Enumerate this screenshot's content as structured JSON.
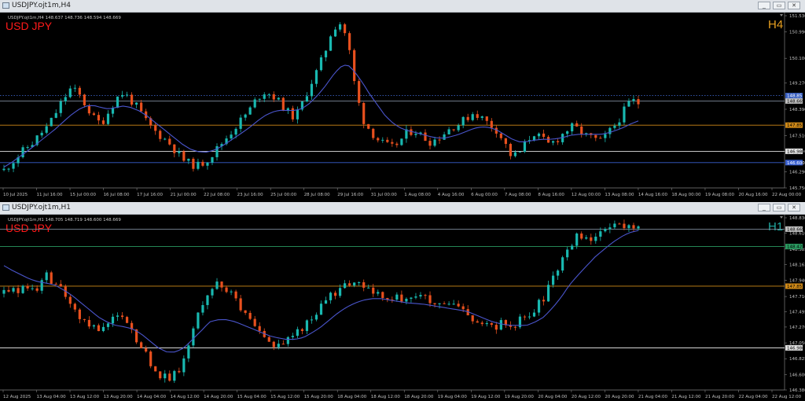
{
  "windows": [
    {
      "title": "USDJPY.ojt1m,H4",
      "symbol": "USD JPY",
      "timeframe": "H4",
      "timeframe_color": "#e8a020",
      "info_line": "USDJPY.ojt1m,H4  148.637 148.736 148.594 148.669",
      "buttons": [
        "_",
        "▭",
        "✕"
      ],
      "colors": {
        "bull": "#19b8b0",
        "bear": "#e8501e",
        "ma": "#4a55cc"
      },
      "chart_data": {
        "type": "candlestick",
        "ylim": [
          145.75,
          151.53
        ],
        "y_ticks": [
          "151.530",
          "150.990",
          "150.100",
          "149.270",
          "148.390",
          "147.510",
          "146.980",
          "146.290",
          "145.750"
        ],
        "x_labels": [
          "10 Jul 2025",
          "11 Jul 16:00",
          "15 Jul 00:00",
          "16 Jul 08:00",
          "17 Jul 16:00",
          "21 Jul 00:00",
          "22 Jul 08:00",
          "23 Jul 16:00",
          "25 Jul 00:00",
          "28 Jul 08:00",
          "29 Jul 16:00",
          "31 Jul 00:00",
          "1 Aug 08:00",
          "4 Aug 16:00",
          "6 Aug 00:00",
          "7 Aug 08:00",
          "8 Aug 16:00",
          "12 Aug 00:00",
          "13 Aug 08:00",
          "14 Aug 16:00",
          "18 Aug 00:00",
          "19 Aug 08:00",
          "20 Aug 16:00",
          "22 Aug 00:00"
        ],
        "close_path": [
          146.35,
          146.6,
          146.85,
          147.1,
          147.3,
          147.6,
          147.85,
          148.3,
          148.75,
          149.1,
          148.9,
          148.5,
          148.1,
          147.9,
          148.3,
          148.75,
          148.95,
          148.7,
          148.4,
          148.0,
          147.7,
          147.5,
          147.3,
          147.0,
          146.7,
          146.55,
          146.5,
          146.65,
          146.9,
          147.2,
          147.5,
          147.8,
          148.1,
          148.4,
          148.8,
          149.0,
          148.85,
          148.6,
          148.3,
          148.1,
          148.6,
          149.2,
          149.7,
          150.3,
          151.1,
          151.3,
          150.8,
          149.2,
          148.1,
          147.7,
          147.4,
          147.2,
          147.1,
          147.3,
          147.6,
          147.7,
          147.5,
          147.3,
          147.4,
          147.6,
          147.8,
          147.9,
          148.1,
          148.3,
          148.1,
          147.9,
          147.7,
          147.3,
          146.8,
          146.9,
          147.3,
          147.6,
          147.4,
          147.2,
          147.35,
          147.6,
          147.8,
          147.7,
          147.5,
          147.4,
          147.3,
          147.6,
          147.9,
          148.3,
          148.7,
          148.6
        ],
        "ma_path": [
          146.45,
          146.6,
          146.78,
          146.96,
          147.15,
          147.35,
          147.55,
          147.75,
          147.98,
          148.2,
          148.38,
          148.5,
          148.52,
          148.45,
          148.4,
          148.45,
          148.5,
          148.45,
          148.35,
          148.2,
          148.0,
          147.8,
          147.6,
          147.4,
          147.2,
          147.05,
          146.97,
          146.95,
          147.0,
          147.12,
          147.28,
          147.45,
          147.62,
          147.8,
          148.0,
          148.18,
          148.3,
          148.36,
          148.35,
          148.35,
          148.42,
          148.6,
          148.85,
          149.15,
          149.5,
          149.8,
          149.9,
          149.65,
          149.3,
          148.9,
          148.55,
          148.2,
          147.95,
          147.78,
          147.68,
          147.62,
          147.55,
          147.48,
          147.43,
          147.42,
          147.48,
          147.55,
          147.65,
          147.75,
          147.8,
          147.78,
          147.7,
          147.55,
          147.4,
          147.3,
          147.3,
          147.35,
          147.38,
          147.38,
          147.4,
          147.45,
          147.52,
          147.55,
          147.55,
          147.55,
          147.55,
          147.6,
          147.68,
          147.78,
          147.9,
          148.0
        ],
        "levels": [
          {
            "price": 148.669,
            "label": "148.669",
            "color": "#7d8a99",
            "style": "solid",
            "tag_bg": "#c0c0c0",
            "tag_fg": "#000"
          },
          {
            "price": 148.85,
            "label": "148.85",
            "color": "#3a60c0",
            "style": "dot",
            "tag_bg": "#3a60c0",
            "tag_fg": "#fff"
          },
          {
            "price": 147.857,
            "label": "147.857",
            "color": "#d08a18",
            "style": "solid",
            "tag_bg": "#d08a18",
            "tag_fg": "#000"
          },
          {
            "price": 146.98,
            "label": "146.980",
            "color": "#e0e0e0",
            "style": "solid",
            "tag_bg": "#e0e0e0",
            "tag_fg": "#000"
          },
          {
            "price": 146.6,
            "label": "146.600",
            "color": "#3a60d0",
            "style": "solid",
            "tag_bg": "#3a60d0",
            "tag_fg": "#fff"
          }
        ]
      }
    },
    {
      "title": "USDJPY.ojt1m,H1",
      "symbol": "USD JPY",
      "timeframe": "H1",
      "timeframe_color": "#20a8a0",
      "info_line": "USDJPY.ojt1m,H1  148.705 148.719 148.600 148.669",
      "buttons": [
        "_",
        "▭",
        "✕"
      ],
      "colors": {
        "bull": "#19b8b0",
        "bear": "#e8501e",
        "ma": "#4a55cc"
      },
      "chart_data": {
        "type": "candlestick",
        "ylim": [
          146.38,
          148.83
        ],
        "y_ticks": [
          "148.830",
          "148.610",
          "148.385",
          "148.163",
          "147.940",
          "147.710",
          "147.495",
          "147.276",
          "147.050",
          "146.825",
          "146.600",
          "146.380"
        ],
        "x_labels": [
          "12 Aug 2025",
          "13 Aug 04:00",
          "13 Aug 12:00",
          "13 Aug 20:00",
          "14 Aug 04:00",
          "14 Aug 12:00",
          "14 Aug 20:00",
          "15 Aug 04:00",
          "15 Aug 12:00",
          "15 Aug 20:00",
          "18 Aug 04:00",
          "18 Aug 12:00",
          "18 Aug 20:00",
          "19 Aug 04:00",
          "19 Aug 12:00",
          "19 Aug 20:00",
          "20 Aug 04:00",
          "20 Aug 12:00",
          "20 Aug 20:00",
          "21 Aug 04:00",
          "21 Aug 12:00",
          "21 Aug 20:00",
          "22 Aug 04:00",
          "22 Aug 12:00"
        ],
        "close_path": [
          147.75,
          147.78,
          147.8,
          147.82,
          147.85,
          148.0,
          147.88,
          147.75,
          147.55,
          147.4,
          147.3,
          147.25,
          147.35,
          147.45,
          147.35,
          147.2,
          147.0,
          146.8,
          146.6,
          146.55,
          146.6,
          146.8,
          147.2,
          147.6,
          147.85,
          147.9,
          147.8,
          147.65,
          147.45,
          147.3,
          147.15,
          147.05,
          147.05,
          147.1,
          147.2,
          147.3,
          147.4,
          147.55,
          147.7,
          147.8,
          147.85,
          147.9,
          147.85,
          147.75,
          147.7,
          147.65,
          147.7,
          147.7,
          147.75,
          147.7,
          147.6,
          147.55,
          147.6,
          147.55,
          147.45,
          147.35,
          147.3,
          147.25,
          147.35,
          147.3,
          147.35,
          147.45,
          147.55,
          147.7,
          147.95,
          148.2,
          148.45,
          148.6,
          148.55,
          148.5,
          148.65,
          148.75,
          148.7,
          148.7,
          148.72
        ],
        "ma_path": [
          148.15,
          148.08,
          148.02,
          147.96,
          147.92,
          147.9,
          147.87,
          147.8,
          147.72,
          147.62,
          147.52,
          147.42,
          147.35,
          147.3,
          147.28,
          147.25,
          147.18,
          147.08,
          146.98,
          146.92,
          146.92,
          146.98,
          147.1,
          147.22,
          147.35,
          147.38,
          147.38,
          147.35,
          147.3,
          147.25,
          147.2,
          147.15,
          147.12,
          147.1,
          147.1,
          147.13,
          147.2,
          147.28,
          147.38,
          147.48,
          147.56,
          147.62,
          147.66,
          147.68,
          147.68,
          147.66,
          147.64,
          147.62,
          147.61,
          147.6,
          147.58,
          147.56,
          147.54,
          147.52,
          147.5,
          147.45,
          147.4,
          147.35,
          147.32,
          147.3,
          147.3,
          147.3,
          147.35,
          147.42,
          147.55,
          147.7,
          147.88,
          148.02,
          148.15,
          148.28,
          148.38,
          148.48,
          148.56,
          148.62,
          148.65
        ],
        "levels": [
          {
            "price": 148.669,
            "label": "148.669",
            "color": "#7d8a99",
            "style": "solid",
            "tag_bg": "#c0c0c0",
            "tag_fg": "#000"
          },
          {
            "price": 148.421,
            "label": "148.421",
            "color": "#2a9a60",
            "style": "solid",
            "tag_bg": "#2a9a60",
            "tag_fg": "#000"
          },
          {
            "price": 147.857,
            "label": "147.857",
            "color": "#d08a18",
            "style": "solid",
            "tag_bg": "#d08a18",
            "tag_fg": "#000"
          },
          {
            "price": 146.98,
            "label": "146.980",
            "color": "#e0e0e0",
            "style": "solid",
            "tag_bg": "#e0e0e0",
            "tag_fg": "#000"
          }
        ]
      }
    }
  ]
}
